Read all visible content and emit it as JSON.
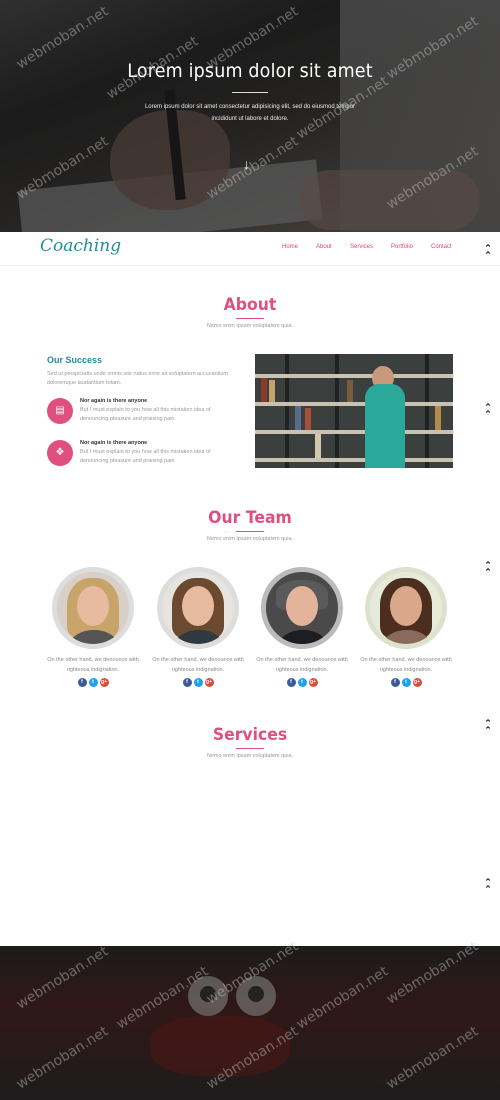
{
  "hero": {
    "title": "Lorem ipsum dolor sit amet",
    "text": "Lorem ipsum dolor sit amet consectetur adipisicing elit, sed do eiusmod tempor incididunt ut labore et dolore.",
    "arrow_icon": "arrow-down-icon"
  },
  "nav": {
    "logo": "Coaching",
    "links": [
      "Home",
      "About",
      "Services",
      "Portfolio",
      "Contact"
    ],
    "accent_color": "#e0507f",
    "logo_color": "#1e8f9c"
  },
  "back_to_top_icon": "double-chevron-up-icon",
  "about": {
    "title": "About",
    "subtitle": "Nemo enim ipsam voluptatem quia.",
    "success_title": "Our Success",
    "success_text": "Sed ut perspiciatis unde omnis iste natus error sit voluptatem accusantium doloremque laudantium totam.",
    "features": [
      {
        "icon": "chart-icon",
        "heading": "Nor again is there anyone",
        "text": "But I must explain to you how all this mistaken idea of denouncing pleasure and praising pain"
      },
      {
        "icon": "award-icon",
        "heading": "Nor again is there anyone",
        "text": "But I must explain to you how all this mistaken idea of denouncing pleasure and praising pain"
      }
    ]
  },
  "team": {
    "title": "Our Team",
    "subtitle": "Nemo enim ipsam voluptatem quia.",
    "members": [
      {
        "desc": "On the other hand, we denounce with righteous indignation."
      },
      {
        "desc": "On the other hand, we denounce with righteous indignation."
      },
      {
        "desc": "On the other hand, we denounce with righteous indignation."
      },
      {
        "desc": "On the other hand, we denounce with righteous indignation."
      }
    ],
    "social_icons": [
      "facebook-icon",
      "twitter-icon",
      "google-plus-icon"
    ],
    "social_glyphs": [
      "f",
      "t",
      "g+"
    ],
    "social_colors": [
      "#3b5998",
      "#1da1f2",
      "#dd4b39"
    ]
  },
  "services": {
    "title": "Services",
    "subtitle": "Nemo enim ipsam voluptatem quia."
  },
  "watermark": "webmoban.net"
}
